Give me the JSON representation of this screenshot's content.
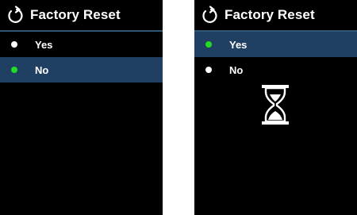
{
  "screens": [
    {
      "title": "Factory Reset",
      "header_icon": "reset-icon",
      "items": [
        {
          "label": "Yes",
          "selected": false,
          "indicator": "white"
        },
        {
          "label": "No",
          "selected": true,
          "indicator": "green"
        }
      ]
    },
    {
      "title": "Factory Reset",
      "header_icon": "reset-icon",
      "items": [
        {
          "label": "Yes",
          "selected": true,
          "indicator": "green"
        },
        {
          "label": "No",
          "selected": false,
          "indicator": "white"
        }
      ],
      "busy_icon": "hourglass-icon"
    }
  ],
  "colors": {
    "background": "#000000",
    "divider": "#2f5673",
    "selection": "#1f3f63",
    "active_indicator": "#22dd22",
    "inactive_indicator": "#ffffff"
  }
}
